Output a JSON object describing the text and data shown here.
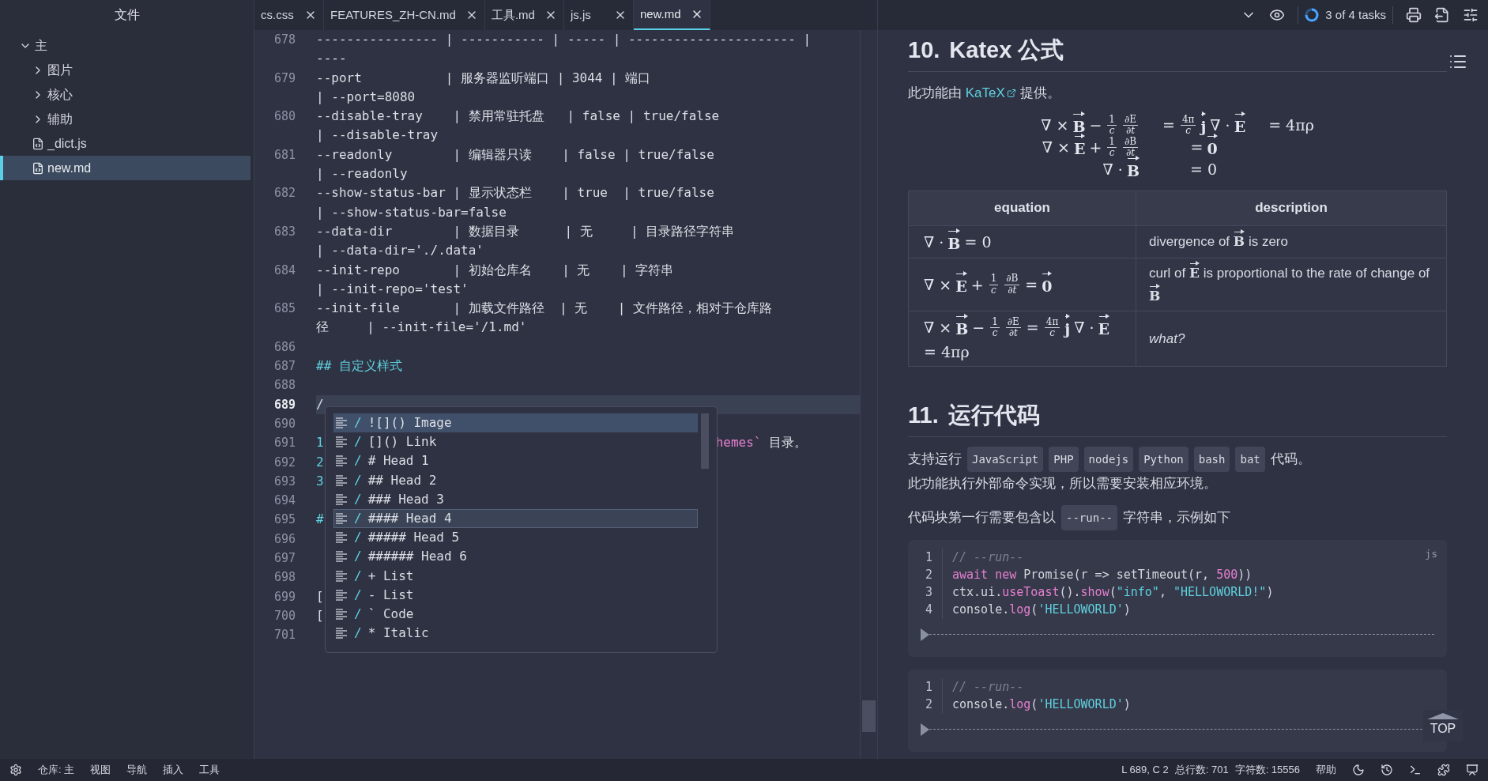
{
  "sidebar": {
    "title": "文件",
    "tree": [
      {
        "label": "主",
        "kind": "folder",
        "expanded": true,
        "selected": false,
        "children": [
          {
            "label": "图片",
            "kind": "folder",
            "expanded": false,
            "selected": false
          },
          {
            "label": "核心",
            "kind": "folder",
            "expanded": false,
            "selected": false
          },
          {
            "label": "辅助",
            "kind": "folder",
            "expanded": false,
            "selected": false
          },
          {
            "label": "_dict.js",
            "kind": "file",
            "selected": false
          },
          {
            "label": "new.md",
            "kind": "file",
            "selected": true
          }
        ]
      }
    ]
  },
  "tabs": [
    {
      "label": "cs.css",
      "selected": false
    },
    {
      "label": "FEATURES_ZH-CN.md",
      "selected": false
    },
    {
      "label": "工具.md",
      "selected": false
    },
    {
      "label": "js.js",
      "selected": false
    },
    {
      "label": "new.md",
      "selected": true
    }
  ],
  "toolbar": {
    "tasks": "3 of 4 tasks"
  },
  "editor": {
    "lines": [
      {
        "number": "678",
        "kind": "plain",
        "current": false,
        "rows": [
          "---------------- | ----------- | ----- | ---------------------- |",
          "----"
        ]
      },
      {
        "number": "679",
        "kind": "plain",
        "current": false,
        "rows": [
          "--port           | 服务器监听端口 | 3044 | 端口",
          "| --port=8080"
        ]
      },
      {
        "number": "680",
        "kind": "plain",
        "current": false,
        "rows": [
          "--disable-tray    | 禁用常驻托盘   | false | true/false",
          "| --disable-tray"
        ]
      },
      {
        "number": "681",
        "kind": "plain",
        "current": false,
        "rows": [
          "--readonly        | 编辑器只读    | false | true/false",
          "| --readonly"
        ]
      },
      {
        "number": "682",
        "kind": "plain",
        "current": false,
        "rows": [
          "--show-status-bar | 显示状态栏    | true  | true/false",
          "| --show-status-bar=false"
        ]
      },
      {
        "number": "683",
        "kind": "plain",
        "current": false,
        "rows": [
          "--data-dir        | 数据目录      | 无     | 目录路径字符串",
          "| --data-dir='./.data'"
        ]
      },
      {
        "number": "684",
        "kind": "plain",
        "current": false,
        "rows": [
          "--init-repo       | 初始仓库名    | 无    | 字符串",
          "| --init-repo='test'"
        ]
      },
      {
        "number": "685",
        "kind": "plain",
        "current": false,
        "rows": [
          "--init-file       | 加载文件路径  | 无    | 文件路径，相对于仓库路",
          "径     | --init-file='/1.md'"
        ]
      },
      {
        "number": "686",
        "kind": "plain",
        "current": false
      },
      {
        "number": "687",
        "kind": "heading",
        "current": false,
        "rows": [
          "## 自定义样式"
        ]
      },
      {
        "number": "688",
        "kind": "plain",
        "current": false
      },
      {
        "number": "689",
        "kind": "plain",
        "current": true,
        "rows": [
          "/"
        ]
      },
      {
        "number": "690",
        "kind": "plain",
        "current": false
      },
      {
        "number": "691",
        "kind": "list",
        "current": false,
        "rows": [
          "1"
        ],
        "tail_code": "hemes`",
        "tail_text": "目录。"
      },
      {
        "number": "692",
        "kind": "list",
        "current": false,
        "rows": [
          "2"
        ]
      },
      {
        "number": "693",
        "kind": "list",
        "current": false,
        "rows": [
          "3"
        ]
      },
      {
        "number": "694",
        "kind": "plain",
        "current": false
      },
      {
        "number": "695",
        "kind": "heading",
        "current": false,
        "rows": [
          "#"
        ]
      },
      {
        "number": "696",
        "kind": "plain",
        "current": false
      },
      {
        "number": "697",
        "kind": "plain",
        "current": false
      },
      {
        "number": "698",
        "kind": "plain",
        "current": false
      },
      {
        "number": "699",
        "kind": "plain",
        "current": false,
        "rows": [
          "["
        ]
      },
      {
        "number": "700",
        "kind": "plain",
        "current": false,
        "rows": [
          "["
        ]
      },
      {
        "number": "701",
        "kind": "plain",
        "current": false
      }
    ],
    "completion": [
      {
        "trigger": "/",
        "label": "![]() Image",
        "selected": true,
        "hovered": false
      },
      {
        "trigger": "/",
        "label": "[]() Link",
        "selected": false,
        "hovered": false
      },
      {
        "trigger": "/",
        "label": "# Head 1",
        "selected": false,
        "hovered": false
      },
      {
        "trigger": "/",
        "label": "## Head 2",
        "selected": false,
        "hovered": false
      },
      {
        "trigger": "/",
        "label": "### Head 3",
        "selected": false,
        "hovered": false
      },
      {
        "trigger": "/",
        "label": "#### Head 4",
        "selected": false,
        "hovered": true
      },
      {
        "trigger": "/",
        "label": "##### Head 5",
        "selected": false,
        "hovered": false
      },
      {
        "trigger": "/",
        "label": "###### Head 6",
        "selected": false,
        "hovered": false
      },
      {
        "trigger": "/",
        "label": "+ List",
        "selected": false,
        "hovered": false
      },
      {
        "trigger": "/",
        "label": "- List",
        "selected": false,
        "hovered": false
      },
      {
        "trigger": "/",
        "label": "` Code",
        "selected": false,
        "hovered": false
      },
      {
        "trigger": "/",
        "label": "* Italic",
        "selected": false,
        "hovered": false
      }
    ]
  },
  "preview": {
    "blocks": [
      {
        "kind": "heading",
        "number": "10.",
        "title": "Katex 公式"
      },
      {
        "kind": "paragraph",
        "lines": [
          [
            {
              "kind": "text",
              "text": "此功能由 "
            },
            {
              "kind": "link",
              "text": "KaTeX"
            },
            {
              "kind": "text",
              "text": " 提供。"
            }
          ]
        ]
      },
      {
        "kind": "math",
        "rows": [
          [
            [
              {
                "kind": "t",
                "text": "∇ ×"
              },
              {
                "kind": "v",
                "text": "B"
              },
              {
                "kind": "t",
                "text": "−"
              },
              {
                "kind": "f",
                "num": "1",
                "den": "c"
              },
              {
                "kind": "f",
                "num": "∂E",
                "den": "∂t"
              }
            ],
            [
              {
                "kind": "t",
                "text": "="
              },
              {
                "kind": "f",
                "num": "4π",
                "den": "c"
              },
              {
                "kind": "v",
                "text": "j"
              },
              {
                "kind": "t",
                "text": "∇ ·"
              },
              {
                "kind": "v",
                "text": "E"
              }
            ],
            [
              {
                "kind": "t",
                "text": "= 4πρ"
              }
            ]
          ],
          [
            [
              {
                "kind": "t",
                "text": "∇ ×"
              },
              {
                "kind": "v",
                "text": "E"
              },
              {
                "kind": "t",
                "text": "+"
              },
              {
                "kind": "f",
                "num": "1",
                "den": "c"
              },
              {
                "kind": "f",
                "num": "∂B",
                "den": "∂t"
              }
            ],
            [
              {
                "kind": "t",
                "text": "="
              },
              {
                "kind": "v",
                "text": "0"
              }
            ]
          ],
          [
            [
              {
                "kind": "t",
                "text": "∇ ·"
              },
              {
                "kind": "v",
                "text": "B"
              }
            ],
            [
              {
                "kind": "t",
                "text": "= 0"
              }
            ]
          ]
        ]
      },
      {
        "kind": "table",
        "columns": [
          "equation",
          "description"
        ],
        "rows": [
          {
            "equation": [
              {
                "kind": "t",
                "text": "∇ ·"
              },
              {
                "kind": "v",
                "text": "B"
              },
              {
                "kind": "t",
                "text": "= 0"
              }
            ],
            "description": "divergence of **B** is zero",
            "italic": false
          },
          {
            "equation": [
              {
                "kind": "t",
                "text": "∇ ×"
              },
              {
                "kind": "v",
                "text": "E"
              },
              {
                "kind": "t",
                "text": "+"
              },
              {
                "kind": "f",
                "num": "1",
                "den": "c"
              },
              {
                "kind": "f",
                "num": "∂B",
                "den": "∂t"
              },
              {
                "kind": "t",
                "text": "="
              },
              {
                "kind": "v",
                "text": "0"
              }
            ],
            "description": "curl of **E** is proportional to the rate of change of **B**",
            "italic": false
          },
          {
            "equation": [
              {
                "kind": "t",
                "text": "∇ ×"
              },
              {
                "kind": "v",
                "text": "B"
              },
              {
                "kind": "t",
                "text": "−"
              },
              {
                "kind": "f",
                "num": "1",
                "den": "c"
              },
              {
                "kind": "f",
                "num": "∂E",
                "den": "∂t"
              },
              {
                "kind": "t",
                "text": "="
              },
              {
                "kind": "f",
                "num": "4π",
                "den": "c"
              },
              {
                "kind": "v",
                "text": "j"
              },
              {
                "kind": "t",
                "text": "∇ ·"
              },
              {
                "kind": "v",
                "text": "E"
              },
              {
                "kind": "t",
                "text": "= 4πρ"
              }
            ],
            "description": "what?",
            "italic": true
          }
        ]
      },
      {
        "kind": "heading",
        "number": "11.",
        "title": "运行代码"
      },
      {
        "kind": "paragraph",
        "lines": [
          [
            {
              "kind": "text",
              "text": "支持运行"
            },
            {
              "kind": "code",
              "text": "JavaScript"
            },
            {
              "kind": "code",
              "text": "PHP"
            },
            {
              "kind": "code",
              "text": "nodejs"
            },
            {
              "kind": "code",
              "text": "Python"
            },
            {
              "kind": "code",
              "text": "bash"
            },
            {
              "kind": "code",
              "text": "bat"
            },
            {
              "kind": "text",
              "text": "代码。"
            }
          ],
          [
            {
              "kind": "text",
              "text": "此功能执行外部命令实现，所以需要安装相应环境。"
            }
          ]
        ]
      },
      {
        "kind": "paragraph",
        "lines": [
          [
            {
              "kind": "text",
              "text": "代码块第一行需要包含以"
            },
            {
              "kind": "code",
              "text": "--run--"
            },
            {
              "kind": "text",
              "text": "字符串，示例如下"
            }
          ]
        ]
      },
      {
        "kind": "code",
        "language": "js",
        "lines": [
          {
            "number": "1",
            "tokens": [
              {
                "kind": "comment",
                "text": "// --run--"
              }
            ]
          },
          {
            "number": "2",
            "tokens": [
              {
                "kind": "keyword",
                "text": "await"
              },
              {
                "kind": "keyword",
                "text": " new"
              },
              {
                "kind": "plain",
                "text": " Promise(r => setTimeout(r, "
              },
              {
                "kind": "number",
                "text": "500"
              },
              {
                "kind": "plain",
                "text": "))"
              }
            ]
          },
          {
            "number": "3",
            "tokens": [
              {
                "kind": "plain",
                "text": "ctx.ui."
              },
              {
                "kind": "func",
                "text": "useToast"
              },
              {
                "kind": "plain",
                "text": "()."
              },
              {
                "kind": "func",
                "text": "show"
              },
              {
                "kind": "plain",
                "text": "("
              },
              {
                "kind": "string",
                "text": "\"info\""
              },
              {
                "kind": "plain",
                "text": ", "
              },
              {
                "kind": "string",
                "text": "\"HELLOWORLD!\""
              },
              {
                "kind": "plain",
                "text": ")"
              }
            ]
          },
          {
            "number": "4",
            "tokens": [
              {
                "kind": "plain",
                "text": "console."
              },
              {
                "kind": "func",
                "text": "log"
              },
              {
                "kind": "plain",
                "text": "("
              },
              {
                "kind": "string",
                "text": "'HELLOWORLD'"
              },
              {
                "kind": "plain",
                "text": ")"
              }
            ]
          }
        ]
      },
      {
        "kind": "code",
        "lines": [
          {
            "number": "1",
            "tokens": [
              {
                "kind": "comment",
                "text": "// --run--"
              }
            ]
          },
          {
            "number": "2",
            "tokens": [
              {
                "kind": "plain",
                "text": "console."
              },
              {
                "kind": "func",
                "text": "log"
              },
              {
                "kind": "plain",
                "text": "("
              },
              {
                "kind": "string",
                "text": "'HELLOWORLD'"
              },
              {
                "kind": "plain",
                "text": ")"
              }
            ]
          }
        ]
      }
    ],
    "top_button": "TOP"
  },
  "status_bar": {
    "left": [
      "仓库: 主",
      "视图",
      "导航",
      "插入",
      "工具"
    ],
    "position": "L 689, C 2",
    "total_lines": "总行数: 701",
    "char_count": "字符数: 15556",
    "help": "帮助"
  }
}
